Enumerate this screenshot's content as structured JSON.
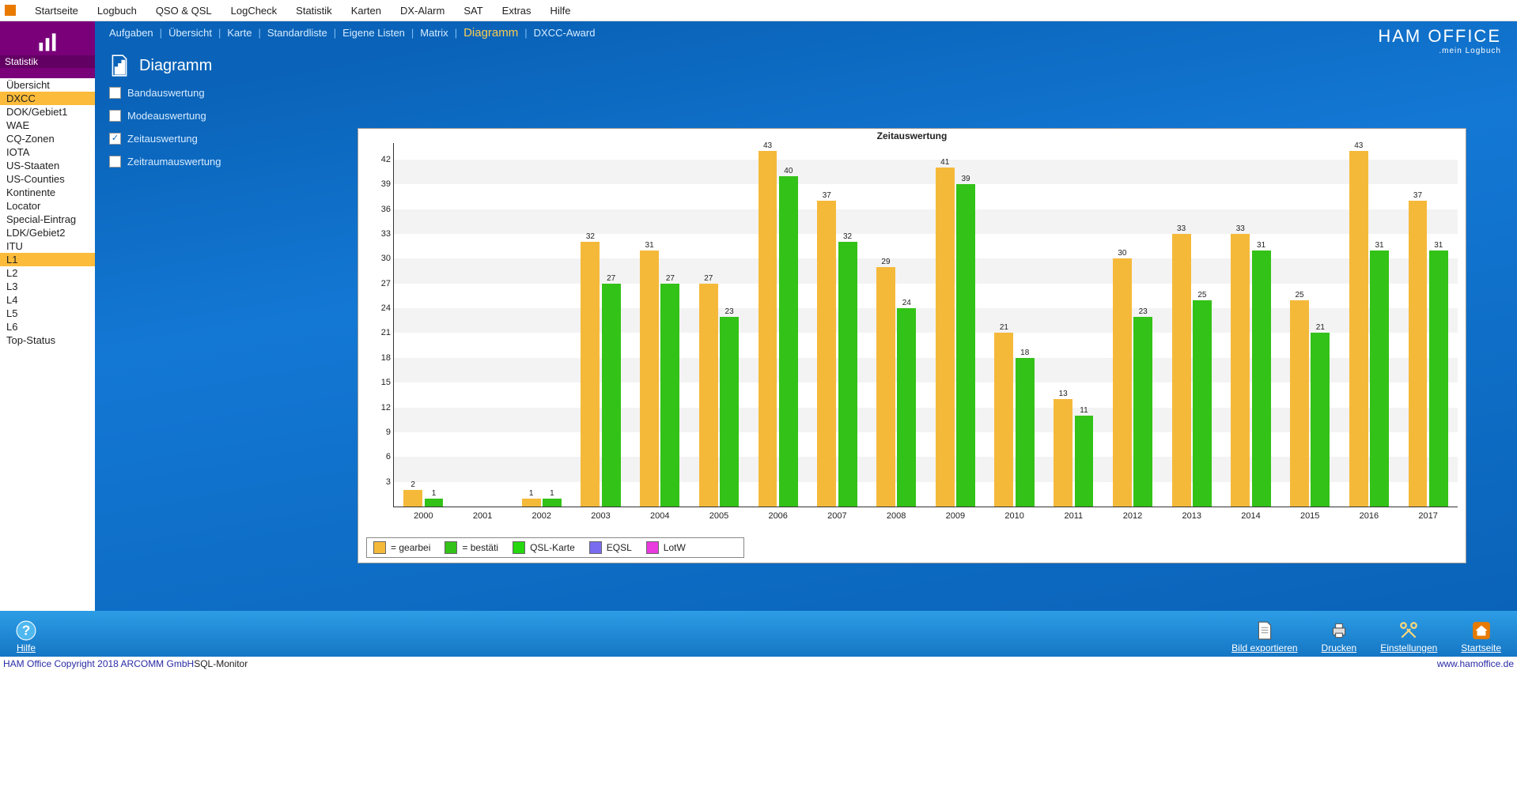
{
  "topmenu": [
    "Startseite",
    "Logbuch",
    "QSO & QSL",
    "LogCheck",
    "Statistik",
    "Karten",
    "DX-Alarm",
    "SAT",
    "Extras",
    "Hilfe"
  ],
  "section_icon_label": "Statistik",
  "sidebar": {
    "items": [
      "Übersicht",
      "DXCC",
      "DOK/Gebiet1",
      "WAE",
      "CQ-Zonen",
      "IOTA",
      "US-Staaten",
      "US-Counties",
      "Kontinente",
      "Locator",
      "Special-Eintrag",
      "LDK/Gebiet2",
      "ITU",
      "L1",
      "L2",
      "L3",
      "L4",
      "L5",
      "L6",
      "Top-Status"
    ],
    "selected": [
      "DXCC",
      "L1"
    ]
  },
  "subtabs": [
    "Aufgaben",
    "Übersicht",
    "Karte",
    "Standardliste",
    "Eigene Listen",
    "Matrix",
    "Diagramm",
    "DXCC-Award"
  ],
  "active_subtab": "Diagramm",
  "brand": {
    "big": "HAM OFFICE",
    "small": ".mein Logbuch"
  },
  "page_title": "Diagramm",
  "options": [
    {
      "label": "Bandauswertung",
      "checked": false
    },
    {
      "label": "Modeauswertung",
      "checked": false
    },
    {
      "label": "Zeitauswertung",
      "checked": true
    },
    {
      "label": "Zeitraumauswertung",
      "checked": false
    }
  ],
  "legend": [
    {
      "label": "= gearbei",
      "color": "#f5b93a"
    },
    {
      "label": "= bestäti",
      "color": "#33c217"
    },
    {
      "label": "QSL-Karte",
      "color": "#25d80f"
    },
    {
      "label": "EQSL",
      "color": "#7a6cf0"
    },
    {
      "label": "LotW",
      "color": "#e93ae0"
    }
  ],
  "toolbar": {
    "help": "Hilfe",
    "export": "Bild exportieren",
    "print": "Drucken",
    "settings": "Einstellungen",
    "home": "Startseite"
  },
  "status": {
    "left": "HAM Office Copyright 2018 ARCOMM GmbH",
    "center": "SQL-Monitor",
    "right": "www.hamoffice.de"
  },
  "chart_data": {
    "type": "bar",
    "title": "Zeitauswertung",
    "categories": [
      "2000",
      "2001",
      "2002",
      "2003",
      "2004",
      "2005",
      "2006",
      "2007",
      "2008",
      "2009",
      "2010",
      "2011",
      "2012",
      "2013",
      "2014",
      "2015",
      "2016",
      "2017"
    ],
    "series": [
      {
        "name": "gearbeitet",
        "color": "#f5b93a",
        "values": [
          2,
          null,
          1,
          32,
          31,
          27,
          43,
          37,
          29,
          41,
          21,
          13,
          30,
          33,
          33,
          25,
          43,
          37
        ]
      },
      {
        "name": "bestätigt",
        "color": "#33c217",
        "values": [
          1,
          null,
          1,
          27,
          27,
          23,
          40,
          32,
          24,
          39,
          18,
          11,
          23,
          25,
          31,
          21,
          31,
          31
        ]
      }
    ],
    "yticks": [
      3,
      6,
      9,
      12,
      15,
      18,
      21,
      24,
      27,
      30,
      33,
      36,
      39,
      42
    ],
    "ylim": [
      0,
      44
    ]
  }
}
